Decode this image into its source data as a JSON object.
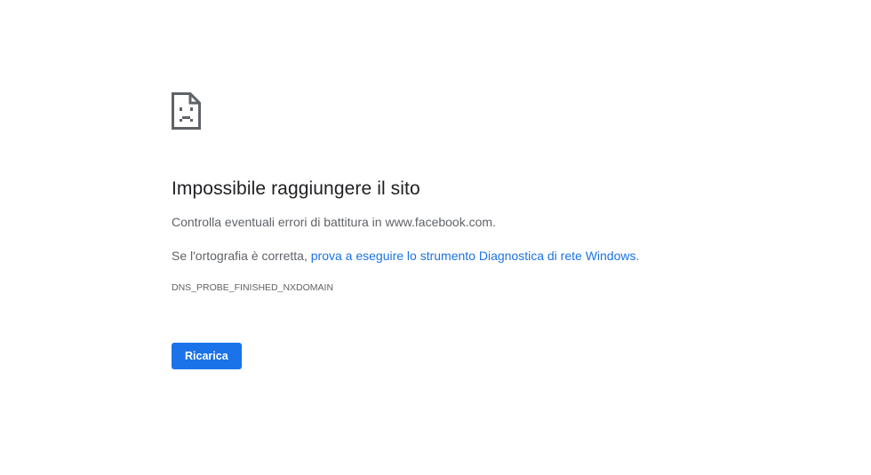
{
  "error": {
    "icon": "sad-page-icon",
    "title": "Impossibile raggiungere il sito",
    "check_text": "Controlla eventuali errori di battitura in www.facebook.com.",
    "spelling_prefix": "Se l'ortografia è corretta, ",
    "diagnostic_link": "prova a eseguire lo strumento Diagnostica di rete Windows",
    "diagnostic_suffix": ".",
    "code": "DNS_PROBE_FINISHED_NXDOMAIN"
  },
  "actions": {
    "reload_label": "Ricarica"
  },
  "colors": {
    "accent": "#1a73e8",
    "title": "#202124",
    "body_text": "#5f6368",
    "background": "#ffffff"
  }
}
